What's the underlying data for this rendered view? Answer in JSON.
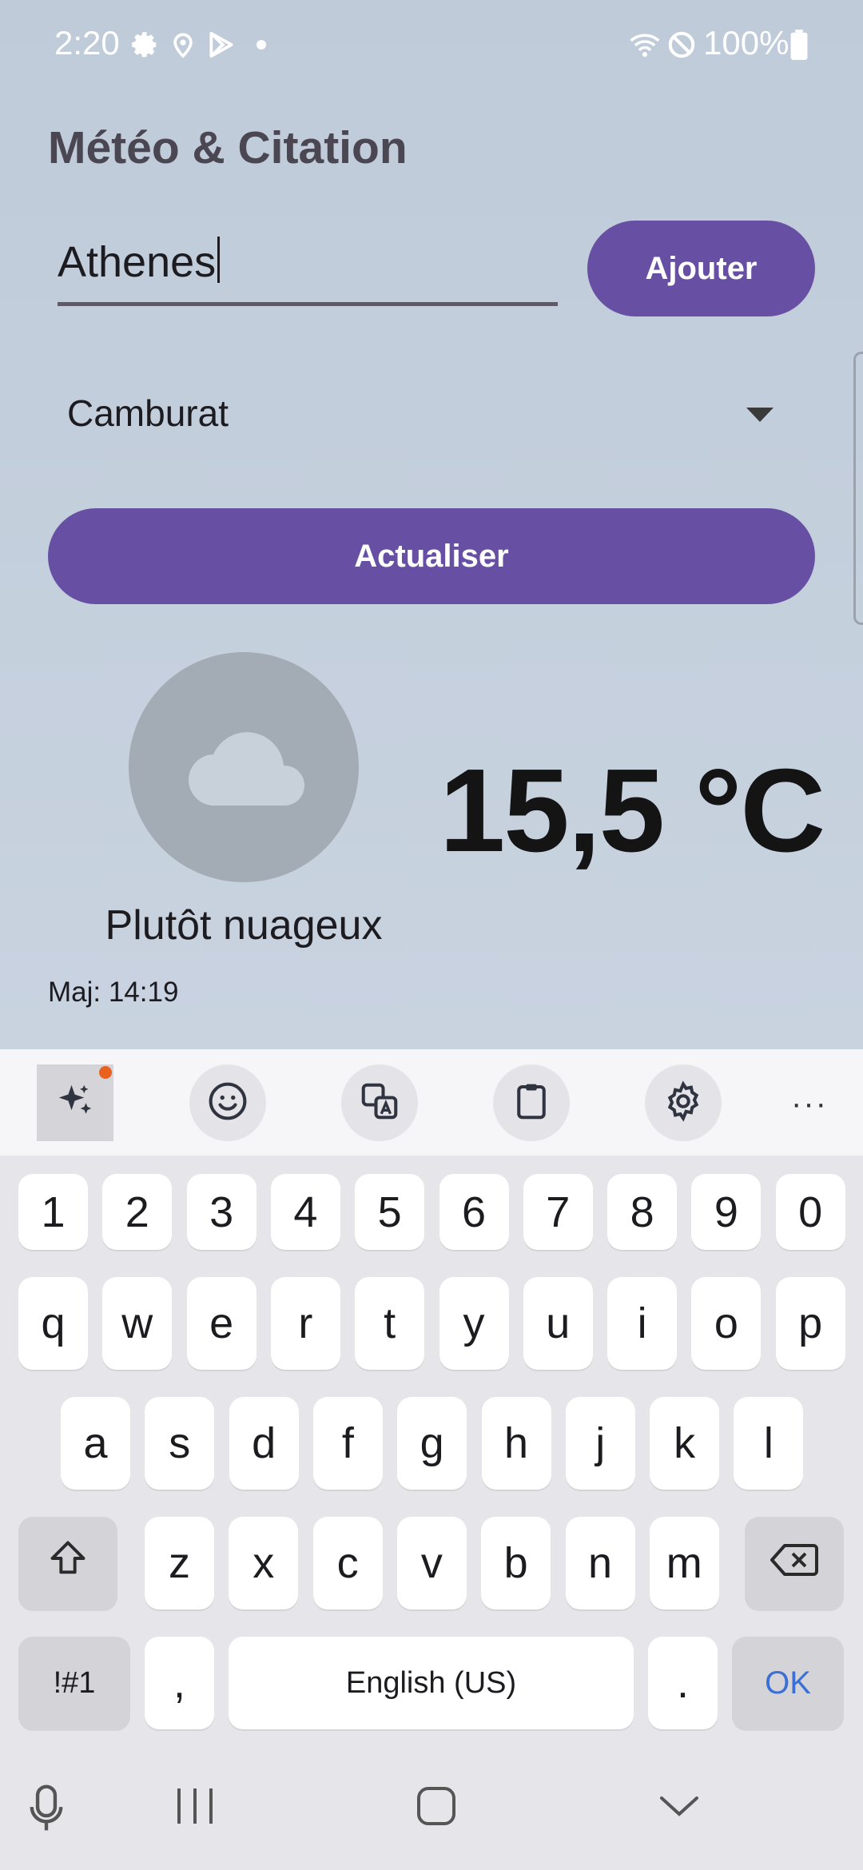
{
  "status_bar": {
    "time": "2:20",
    "battery": "100%",
    "icons": [
      "settings-icon",
      "location-icon",
      "play-store-icon",
      "dot-icon",
      "wifi-icon",
      "do-not-disturb-icon",
      "battery-icon"
    ]
  },
  "app": {
    "title": "Météo & Citation",
    "city_input": {
      "value": "Athenes"
    },
    "add_button": "Ajouter",
    "city_select": {
      "selected": "Camburat"
    },
    "refresh_button": "Actualiser",
    "weather": {
      "description": "Plutôt nuageux",
      "temperature": "15,5 °C",
      "icon": "cloud-icon",
      "updated": "Maj: 14:19"
    }
  },
  "keyboard": {
    "toolbar": [
      "ai-sparkle-icon",
      "emoji-icon",
      "translate-icon",
      "clipboard-icon",
      "settings-icon",
      "more-icon"
    ],
    "more_label": "···",
    "row_numbers": [
      "1",
      "2",
      "3",
      "4",
      "5",
      "6",
      "7",
      "8",
      "9",
      "0"
    ],
    "row1": [
      "q",
      "w",
      "e",
      "r",
      "t",
      "y",
      "u",
      "i",
      "o",
      "p"
    ],
    "row2": [
      "a",
      "s",
      "d",
      "f",
      "g",
      "h",
      "j",
      "k",
      "l"
    ],
    "row3": [
      "z",
      "x",
      "c",
      "v",
      "b",
      "n",
      "m"
    ],
    "symbols": "!#1",
    "comma": ",",
    "space": "English (US)",
    "period": ".",
    "ok": "OK"
  },
  "colors": {
    "accent": "#6750a4",
    "background": "#c5d0de",
    "ok_text": "#3b6fd6"
  }
}
